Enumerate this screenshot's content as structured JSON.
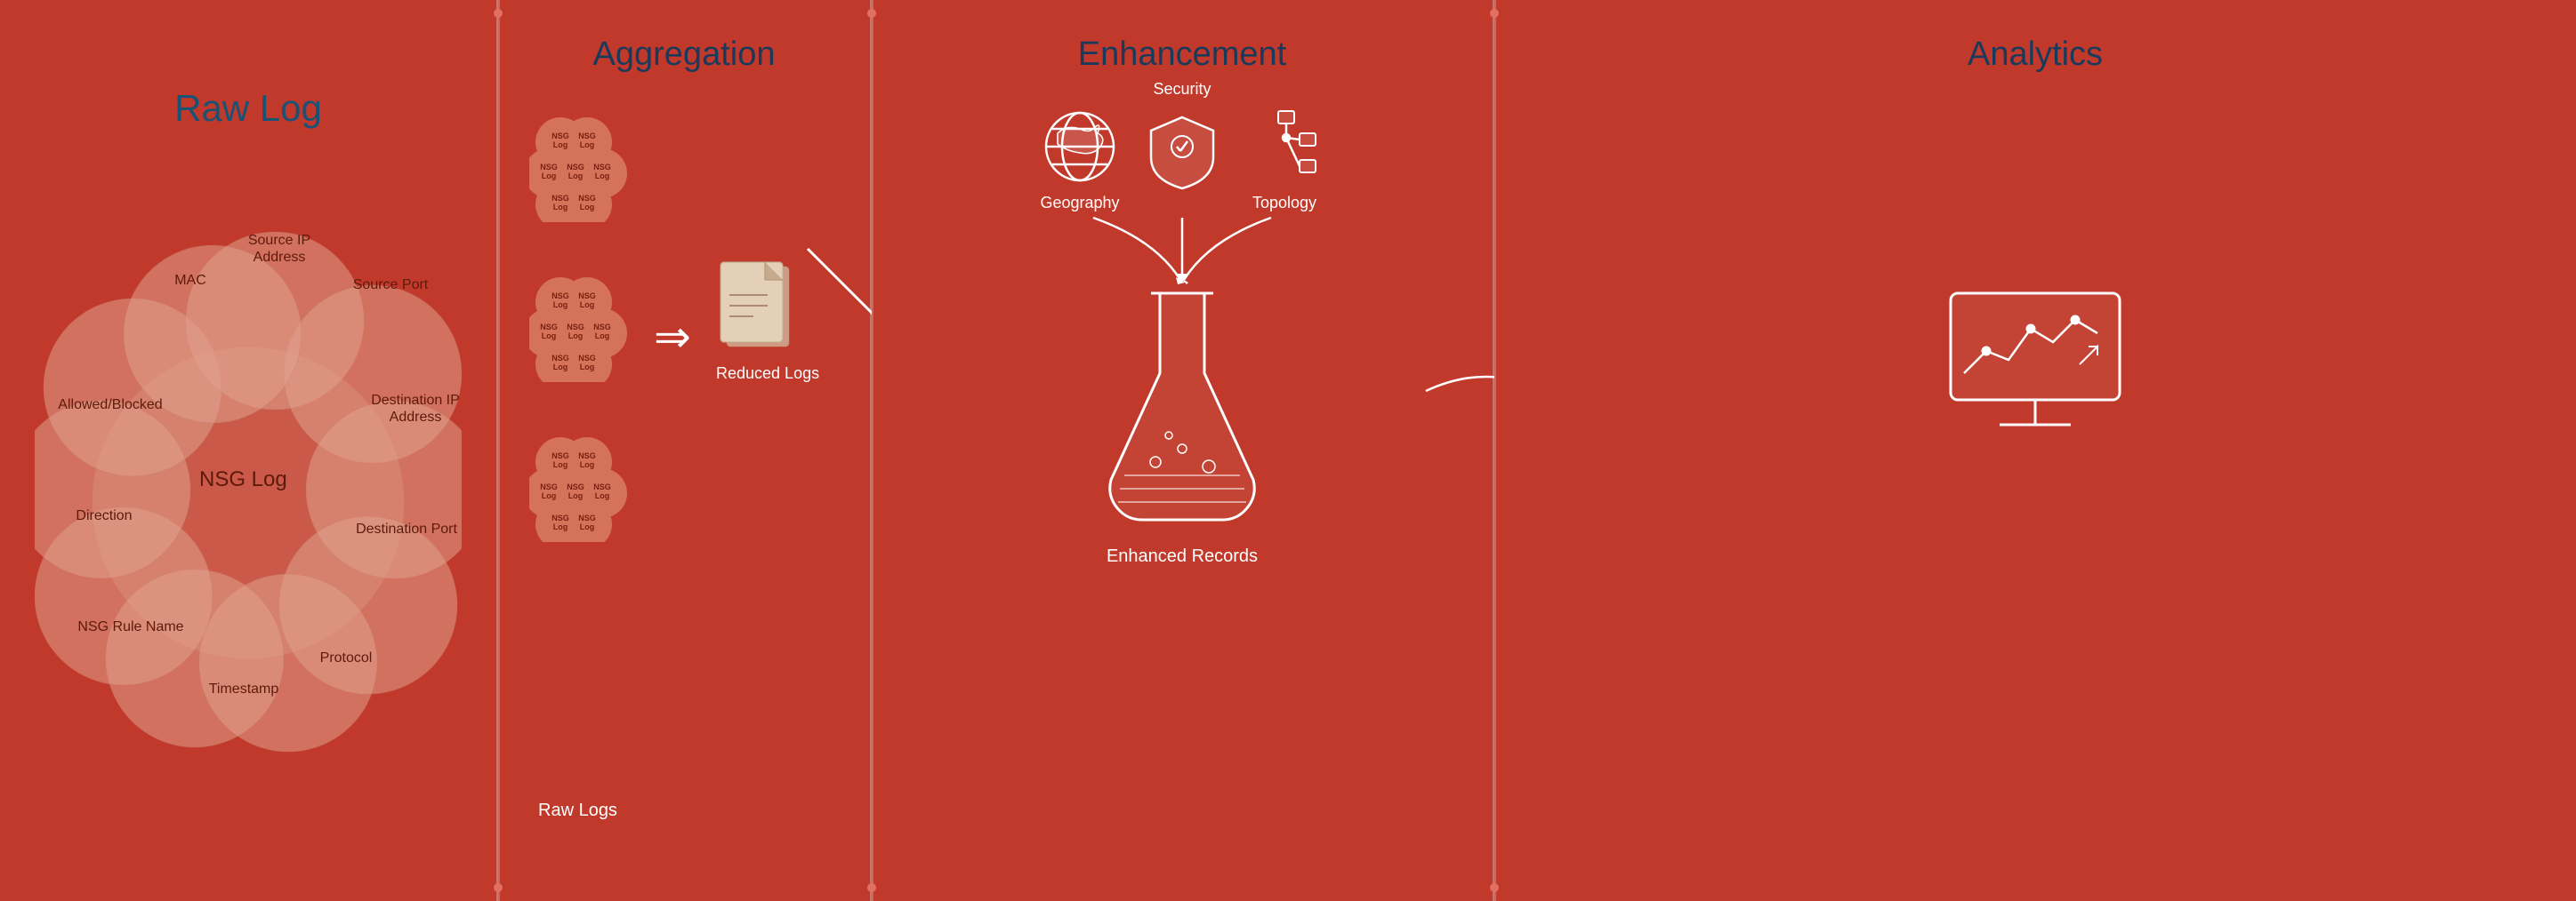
{
  "leftPanel": {
    "title": "Raw Log",
    "centerLabel": "NSG Log",
    "fields": [
      "MAC",
      "Source IP Address",
      "Source Port",
      "Destination IP\nAddress",
      "Destination Port",
      "Protocol",
      "Timestamp",
      "NSG Rule Name",
      "Direction",
      "Allowed/Blocked"
    ]
  },
  "aggregation": {
    "title": "Aggregation",
    "groups": [
      "NSG Log",
      "NSG Log",
      "NSG Log"
    ],
    "arrow": "⇒",
    "reducedLabel": "Reduced Logs",
    "rawLabel": "Raw Logs"
  },
  "enhancement": {
    "title": "Enhancement",
    "icons": [
      {
        "label": "Geography"
      },
      {
        "label": "Security"
      },
      {
        "label": "Topology"
      }
    ],
    "flaskLabel": "Enhanced Records"
  },
  "analytics": {
    "title": "Analytics"
  },
  "colors": {
    "background": "#c0392b",
    "circleColor": "rgba(224,160,140,0.6)",
    "titleBlue": "#1a4c7c",
    "textDark": "#7a2010",
    "white": "#ffffff"
  }
}
